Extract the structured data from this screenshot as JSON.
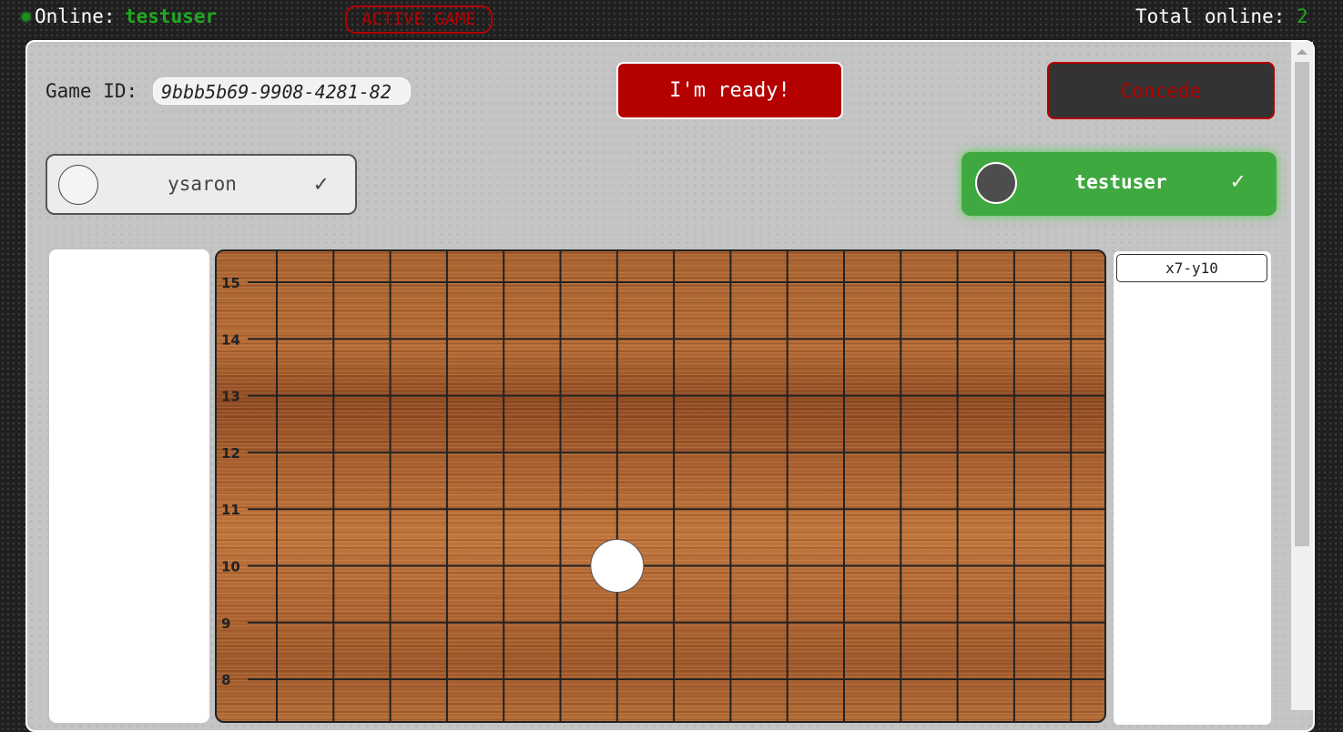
{
  "header": {
    "online_label": "Online:",
    "username": "testuser",
    "game_status": "ACTIVE GAME",
    "total_label": "Total online:",
    "total_count": "2"
  },
  "game": {
    "id_label": "Game ID:",
    "id_value": "9bbb5b69-9908-4281-82",
    "ready_button": "I'm ready!",
    "concede_button": "Concede"
  },
  "players": [
    {
      "name": "ysaron",
      "stone_color": "white",
      "ready_mark": "✓",
      "active": false
    },
    {
      "name": "testuser",
      "stone_color": "black",
      "ready_mark": "✓",
      "active": true
    }
  ],
  "moves": [
    "x7-y10"
  ],
  "board": {
    "row_labels": [
      "15",
      "14",
      "13",
      "12",
      "11",
      "10",
      "9",
      "8"
    ],
    "stones": [
      {
        "x": 7,
        "y": 10,
        "color": "white"
      }
    ]
  },
  "colors": {
    "accent_red": "#b50000",
    "online_green": "#1faa1f",
    "active_player_green": "#3fa83f"
  }
}
